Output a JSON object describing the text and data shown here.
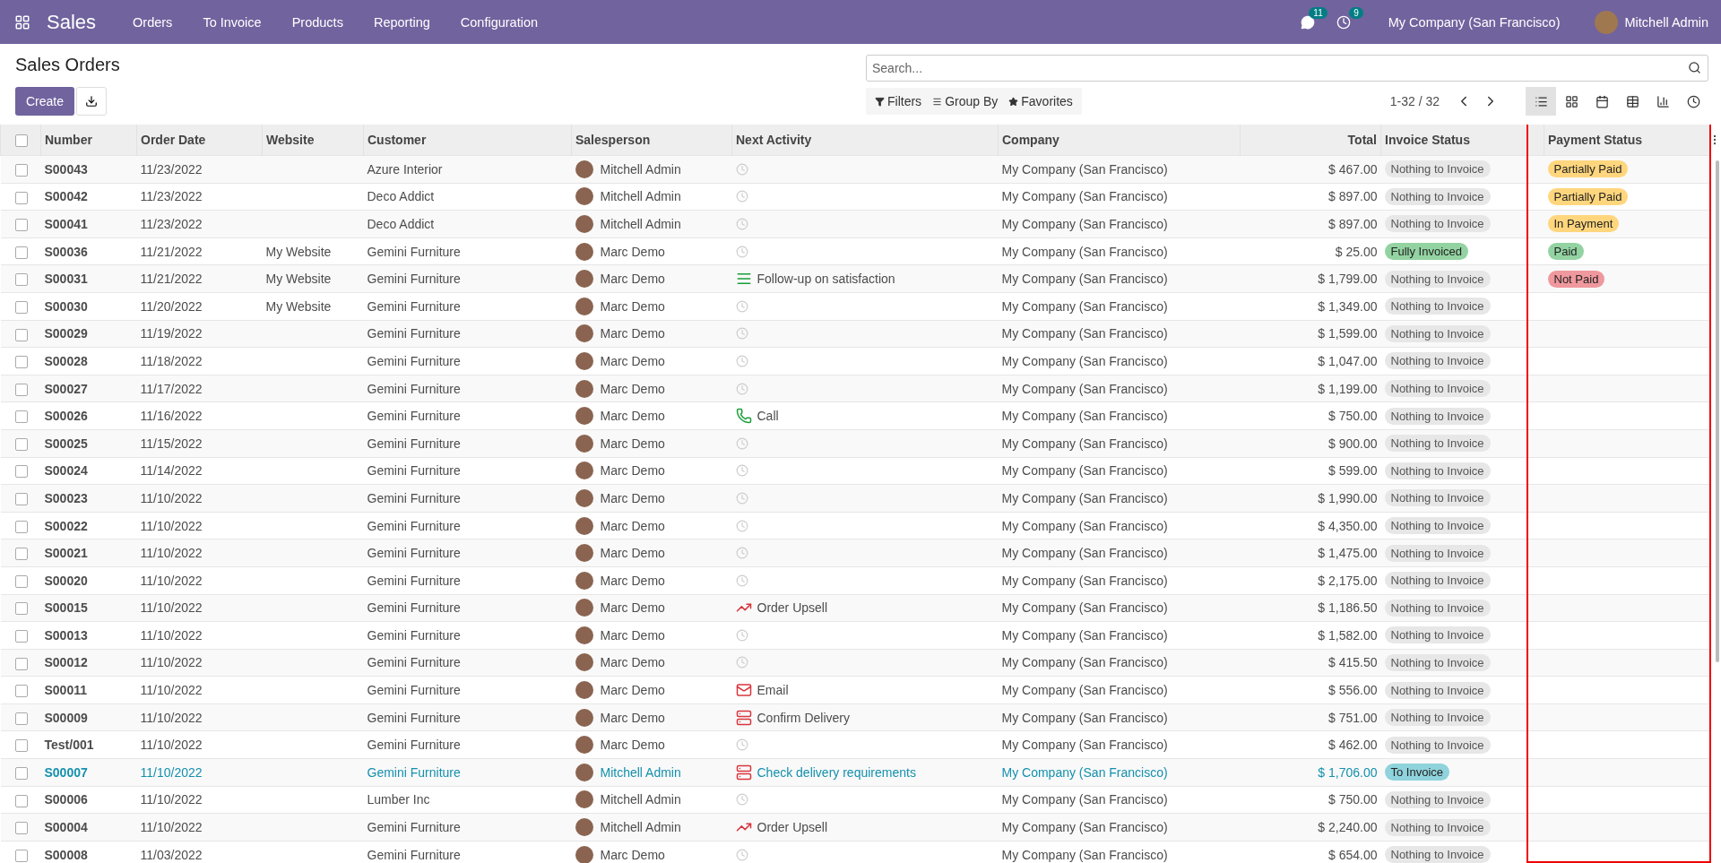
{
  "navbar": {
    "app_name": "Sales",
    "menu": [
      "Orders",
      "To Invoice",
      "Products",
      "Reporting",
      "Configuration"
    ],
    "messages_count": "11",
    "activities_count": "9",
    "company": "My Company (San Francisco)",
    "user": "Mitchell Admin"
  },
  "control_panel": {
    "title": "Sales Orders",
    "create_label": "Create",
    "search_placeholder": "Search...",
    "filters": [
      "Filters",
      "Group By",
      "Favorites"
    ],
    "pager": "1-32 / 32",
    "views": [
      {
        "kind": "list",
        "selected": true
      },
      {
        "kind": "kanban",
        "selected": false
      },
      {
        "kind": "calendar",
        "selected": false
      },
      {
        "kind": "pivot",
        "selected": false
      },
      {
        "kind": "graph",
        "selected": false
      },
      {
        "kind": "activity",
        "selected": false
      }
    ]
  },
  "table": {
    "select_all_checked": false,
    "columns": [
      "Number",
      "Order Date",
      "Website",
      "Customer",
      "Salesperson",
      "Next Activity",
      "Company",
      "Total",
      "Invoice Status",
      "Payment Status"
    ],
    "rows": [
      {
        "number": "S00043",
        "date": "11/23/2022",
        "customer": "Azure Interior",
        "salesperson": "Mitchell Admin",
        "activity": {
          "kind": "none"
        },
        "company": "My Company (San Francisco)",
        "total": "$ 467.00",
        "invoice_status": {
          "label": "Nothing to Invoice",
          "color": "#e7e7e7"
        },
        "payment_status": {
          "label": "Partially Paid",
          "color": "#ffd67d"
        },
        "checked": false,
        "highlighted": false
      },
      {
        "number": "S00042",
        "date": "11/23/2022",
        "customer": "Deco Addict",
        "salesperson": "Mitchell Admin",
        "activity": {
          "kind": "none"
        },
        "company": "My Company (San Francisco)",
        "total": "$ 897.00",
        "invoice_status": {
          "label": "Nothing to Invoice",
          "color": "#e7e7e7"
        },
        "payment_status": {
          "label": "Partially Paid",
          "color": "#ffd67d"
        },
        "checked": false,
        "highlighted": false
      },
      {
        "number": "S00041",
        "date": "11/23/2022",
        "customer": "Deco Addict",
        "salesperson": "Mitchell Admin",
        "activity": {
          "kind": "none"
        },
        "company": "My Company (San Francisco)",
        "total": "$ 897.00",
        "invoice_status": {
          "label": "Nothing to Invoice",
          "color": "#e7e7e7"
        },
        "payment_status": {
          "label": "In Payment",
          "color": "#ffd67d"
        },
        "checked": false,
        "highlighted": false
      },
      {
        "number": "S00036",
        "date": "11/21/2022",
        "website": "My Website",
        "customer": "Gemini Furniture",
        "salesperson": "Marc Demo",
        "activity": {
          "kind": "none"
        },
        "company": "My Company (San Francisco)",
        "total": "$ 25.00",
        "invoice_status": {
          "label": "Fully Invoiced",
          "color": "#93d3a2"
        },
        "payment_status": {
          "label": "Paid",
          "color": "#93d3a2"
        },
        "checked": false,
        "highlighted": false
      },
      {
        "number": "S00031",
        "date": "11/21/2022",
        "website": "My Website",
        "customer": "Gemini Furniture",
        "salesperson": "Marc Demo",
        "activity": {
          "kind": "follow_up",
          "label": "Follow-up on satisfaction"
        },
        "company": "My Company (San Francisco)",
        "total": "$ 1,799.00",
        "invoice_status": {
          "label": "Nothing to Invoice",
          "color": "#e7e7e7"
        },
        "payment_status": {
          "label": "Not Paid",
          "color": "#ef989d"
        },
        "checked": false,
        "highlighted": false
      },
      {
        "number": "S00030",
        "date": "11/20/2022",
        "website": "My Website",
        "customer": "Gemini Furniture",
        "salesperson": "Marc Demo",
        "activity": {
          "kind": "none"
        },
        "company": "My Company (San Francisco)",
        "total": "$ 1,349.00",
        "invoice_status": {
          "label": "Nothing to Invoice",
          "color": "#e7e7e7"
        },
        "checked": false,
        "highlighted": false
      },
      {
        "number": "S00029",
        "date": "11/19/2022",
        "customer": "Gemini Furniture",
        "salesperson": "Marc Demo",
        "activity": {
          "kind": "none"
        },
        "company": "My Company (San Francisco)",
        "total": "$ 1,599.00",
        "invoice_status": {
          "label": "Nothing to Invoice",
          "color": "#e7e7e7"
        },
        "checked": false,
        "highlighted": false
      },
      {
        "number": "S00028",
        "date": "11/18/2022",
        "customer": "Gemini Furniture",
        "salesperson": "Marc Demo",
        "activity": {
          "kind": "none"
        },
        "company": "My Company (San Francisco)",
        "total": "$ 1,047.00",
        "invoice_status": {
          "label": "Nothing to Invoice",
          "color": "#e7e7e7"
        },
        "checked": false,
        "highlighted": false
      },
      {
        "number": "S00027",
        "date": "11/17/2022",
        "customer": "Gemini Furniture",
        "salesperson": "Marc Demo",
        "activity": {
          "kind": "none"
        },
        "company": "My Company (San Francisco)",
        "total": "$ 1,199.00",
        "invoice_status": {
          "label": "Nothing to Invoice",
          "color": "#e7e7e7"
        },
        "checked": false,
        "highlighted": false
      },
      {
        "number": "S00026",
        "date": "11/16/2022",
        "customer": "Gemini Furniture",
        "salesperson": "Marc Demo",
        "activity": {
          "kind": "call",
          "label": "Call"
        },
        "company": "My Company (San Francisco)",
        "total": "$ 750.00",
        "invoice_status": {
          "label": "Nothing to Invoice",
          "color": "#e7e7e7"
        },
        "checked": false,
        "highlighted": false
      },
      {
        "number": "S00025",
        "date": "11/15/2022",
        "customer": "Gemini Furniture",
        "salesperson": "Marc Demo",
        "activity": {
          "kind": "none"
        },
        "company": "My Company (San Francisco)",
        "total": "$ 900.00",
        "invoice_status": {
          "label": "Nothing to Invoice",
          "color": "#e7e7e7"
        },
        "checked": false,
        "highlighted": false
      },
      {
        "number": "S00024",
        "date": "11/14/2022",
        "customer": "Gemini Furniture",
        "salesperson": "Marc Demo",
        "activity": {
          "kind": "none"
        },
        "company": "My Company (San Francisco)",
        "total": "$ 599.00",
        "invoice_status": {
          "label": "Nothing to Invoice",
          "color": "#e7e7e7"
        },
        "checked": false,
        "highlighted": false
      },
      {
        "number": "S00023",
        "date": "11/10/2022",
        "customer": "Gemini Furniture",
        "salesperson": "Marc Demo",
        "activity": {
          "kind": "none"
        },
        "company": "My Company (San Francisco)",
        "total": "$ 1,990.00",
        "invoice_status": {
          "label": "Nothing to Invoice",
          "color": "#e7e7e7"
        },
        "checked": false,
        "highlighted": false
      },
      {
        "number": "S00022",
        "date": "11/10/2022",
        "customer": "Gemini Furniture",
        "salesperson": "Marc Demo",
        "activity": {
          "kind": "none"
        },
        "company": "My Company (San Francisco)",
        "total": "$ 4,350.00",
        "invoice_status": {
          "label": "Nothing to Invoice",
          "color": "#e7e7e7"
        },
        "checked": false,
        "highlighted": false
      },
      {
        "number": "S00021",
        "date": "11/10/2022",
        "customer": "Gemini Furniture",
        "salesperson": "Marc Demo",
        "activity": {
          "kind": "none"
        },
        "company": "My Company (San Francisco)",
        "total": "$ 1,475.00",
        "invoice_status": {
          "label": "Nothing to Invoice",
          "color": "#e7e7e7"
        },
        "checked": false,
        "highlighted": false
      },
      {
        "number": "S00020",
        "date": "11/10/2022",
        "customer": "Gemini Furniture",
        "salesperson": "Marc Demo",
        "activity": {
          "kind": "none"
        },
        "company": "My Company (San Francisco)",
        "total": "$ 2,175.00",
        "invoice_status": {
          "label": "Nothing to Invoice",
          "color": "#e7e7e7"
        },
        "checked": false,
        "highlighted": false
      },
      {
        "number": "S00015",
        "date": "11/10/2022",
        "customer": "Gemini Furniture",
        "salesperson": "Marc Demo",
        "activity": {
          "kind": "upsell",
          "label": "Order Upsell"
        },
        "company": "My Company (San Francisco)",
        "total": "$ 1,186.50",
        "invoice_status": {
          "label": "Nothing to Invoice",
          "color": "#e7e7e7"
        },
        "checked": false,
        "highlighted": false
      },
      {
        "number": "S00013",
        "date": "11/10/2022",
        "customer": "Gemini Furniture",
        "salesperson": "Marc Demo",
        "activity": {
          "kind": "none"
        },
        "company": "My Company (San Francisco)",
        "total": "$ 1,582.00",
        "invoice_status": {
          "label": "Nothing to Invoice",
          "color": "#e7e7e7"
        },
        "checked": false,
        "highlighted": false
      },
      {
        "number": "S00012",
        "date": "11/10/2022",
        "customer": "Gemini Furniture",
        "salesperson": "Marc Demo",
        "activity": {
          "kind": "none"
        },
        "company": "My Company (San Francisco)",
        "total": "$ 415.50",
        "invoice_status": {
          "label": "Nothing to Invoice",
          "color": "#e7e7e7"
        },
        "checked": false,
        "highlighted": false
      },
      {
        "number": "S00011",
        "date": "11/10/2022",
        "customer": "Gemini Furniture",
        "salesperson": "Marc Demo",
        "activity": {
          "kind": "email",
          "label": "Email"
        },
        "company": "My Company (San Francisco)",
        "total": "$ 556.00",
        "invoice_status": {
          "label": "Nothing to Invoice",
          "color": "#e7e7e7"
        },
        "checked": false,
        "highlighted": false
      },
      {
        "number": "S00009",
        "date": "11/10/2022",
        "customer": "Gemini Furniture",
        "salesperson": "Marc Demo",
        "activity": {
          "kind": "delivery",
          "label": "Confirm Delivery"
        },
        "company": "My Company (San Francisco)",
        "total": "$ 751.00",
        "invoice_status": {
          "label": "Nothing to Invoice",
          "color": "#e7e7e7"
        },
        "checked": false,
        "highlighted": false
      },
      {
        "number": "Test/001",
        "date": "11/10/2022",
        "customer": "Gemini Furniture",
        "salesperson": "Marc Demo",
        "activity": {
          "kind": "none"
        },
        "company": "My Company (San Francisco)",
        "total": "$ 462.00",
        "invoice_status": {
          "label": "Nothing to Invoice",
          "color": "#e7e7e7"
        },
        "checked": false,
        "highlighted": false
      },
      {
        "number": "S00007",
        "date": "11/10/2022",
        "customer": "Gemini Furniture",
        "salesperson": "Mitchell Admin",
        "activity": {
          "kind": "delivery",
          "label": "Check delivery requirements"
        },
        "company": "My Company (San Francisco)",
        "total": "$ 1,706.00",
        "invoice_status": {
          "label": "To Invoice",
          "color": "#8fd3dc"
        },
        "checked": false,
        "highlighted": true
      },
      {
        "number": "S00006",
        "date": "11/10/2022",
        "customer": "Lumber Inc",
        "salesperson": "Mitchell Admin",
        "activity": {
          "kind": "none"
        },
        "company": "My Company (San Francisco)",
        "total": "$ 750.00",
        "invoice_status": {
          "label": "Nothing to Invoice",
          "color": "#e7e7e7"
        },
        "checked": false,
        "highlighted": false
      },
      {
        "number": "S00004",
        "date": "11/10/2022",
        "customer": "Gemini Furniture",
        "salesperson": "Mitchell Admin",
        "activity": {
          "kind": "upsell",
          "label": "Order Upsell"
        },
        "company": "My Company (San Francisco)",
        "total": "$ 2,240.00",
        "invoice_status": {
          "label": "Nothing to Invoice",
          "color": "#e7e7e7"
        },
        "checked": false,
        "highlighted": false
      },
      {
        "number": "S00008",
        "date": "11/03/2022",
        "customer": "Gemini Furniture",
        "salesperson": "Marc Demo",
        "activity": {
          "kind": "none"
        },
        "company": "My Company (San Francisco)",
        "total": "$ 654.00",
        "invoice_status": {
          "label": "Nothing to Invoice",
          "color": "#e7e7e7"
        },
        "checked": false,
        "highlighted": false
      }
    ]
  }
}
